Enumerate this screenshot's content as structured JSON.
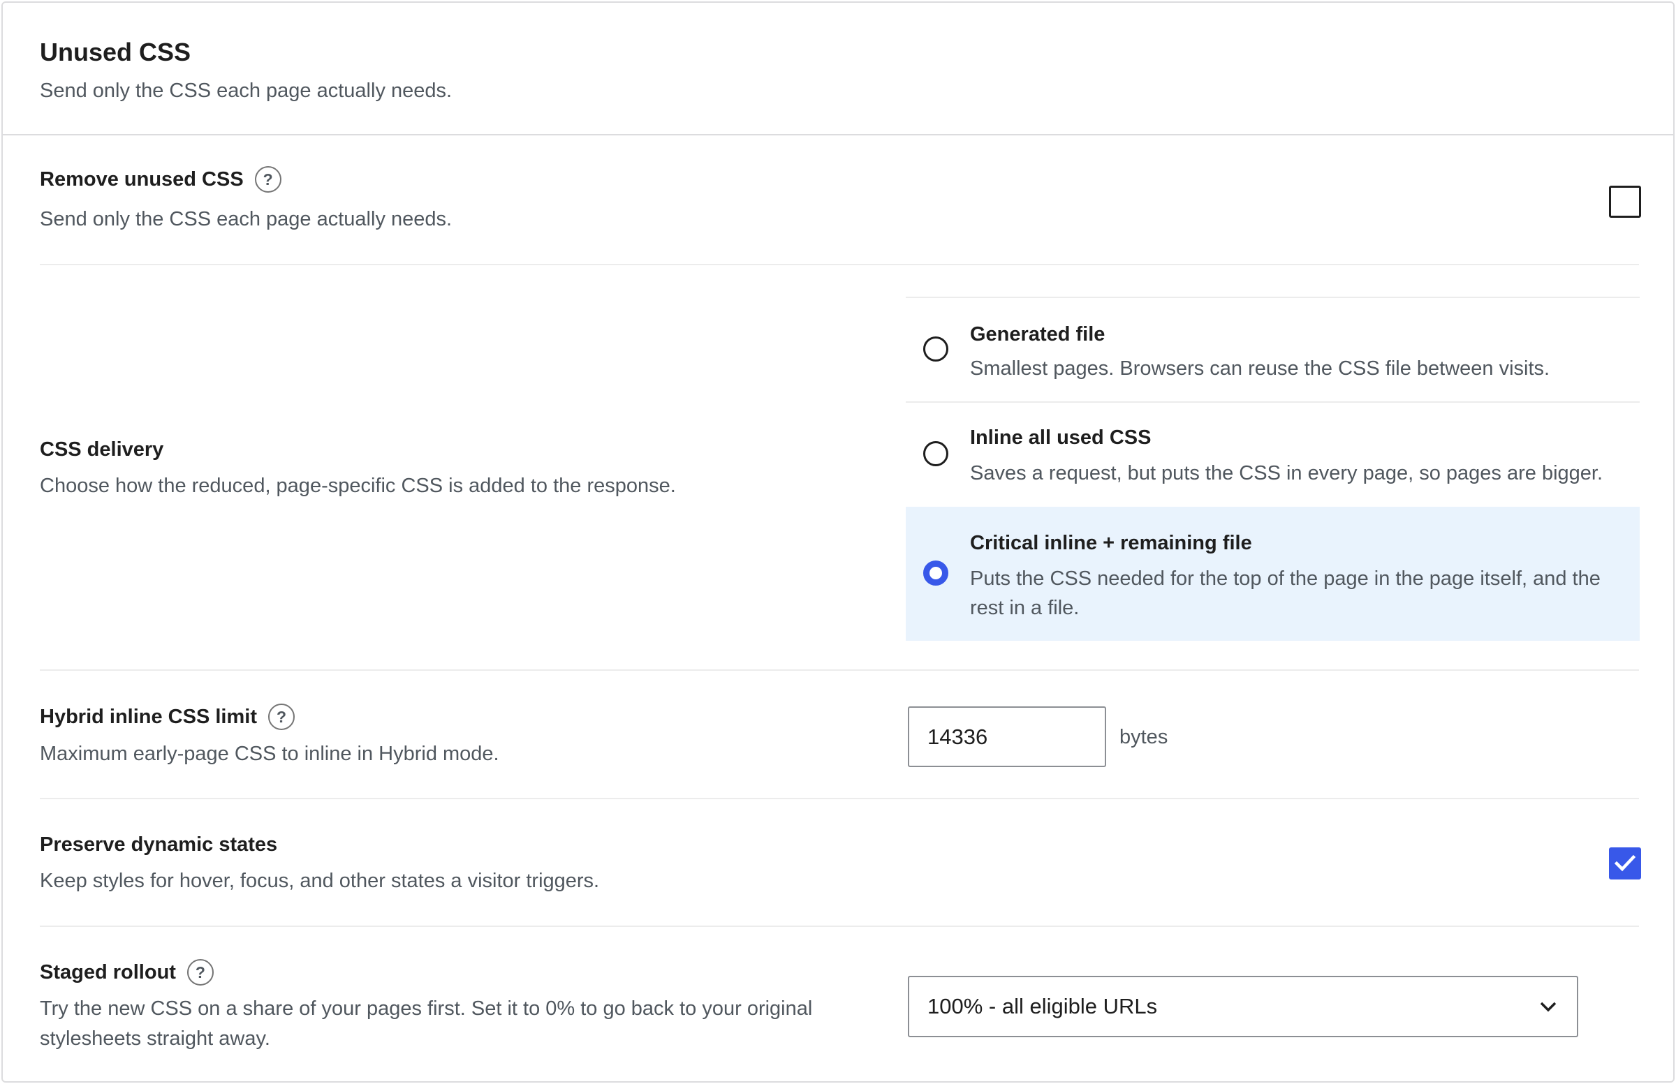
{
  "header": {
    "title": "Unused CSS",
    "subtitle": "Send only the CSS each page actually needs."
  },
  "remove_unused": {
    "title": "Remove unused CSS",
    "help_glyph": "?",
    "description": "Send only the CSS each page actually needs.",
    "checked": false
  },
  "css_delivery": {
    "title": "CSS delivery",
    "description": "Choose how the reduced, page-specific CSS is added to the response.",
    "selected": "critical",
    "options": [
      {
        "id": "file",
        "label": "Generated file",
        "description": "Smallest pages. Browsers can reuse the CSS file between visits."
      },
      {
        "id": "inline",
        "label": "Inline all used CSS",
        "description": "Saves a request, but puts the CSS in every page, so pages are bigger."
      },
      {
        "id": "critical",
        "label": "Critical inline + remaining file",
        "description": "Puts the CSS needed for the top of the page in the page itself, and the rest in a file."
      }
    ]
  },
  "hybrid_limit": {
    "title": "Hybrid inline CSS limit",
    "help_glyph": "?",
    "description": "Maximum early-page CSS to inline in Hybrid mode.",
    "value": "14336",
    "unit": "bytes"
  },
  "preserve_states": {
    "title": "Preserve dynamic states",
    "description": "Keep styles for hover, focus, and other states a visitor triggers.",
    "checked": true
  },
  "staged_rollout": {
    "title": "Staged rollout",
    "help_glyph": "?",
    "description_line1": "Try the new CSS on a share of your pages first. Set it to 0% to go back to your original",
    "description_line2": "stylesheets straight away.",
    "selected_value": "100% - all eligible URLs"
  },
  "colors": {
    "accent": "#3858e9",
    "selected_bg": "#e9f3fd",
    "border": "#dcdcde",
    "muted_text": "#50575e"
  }
}
